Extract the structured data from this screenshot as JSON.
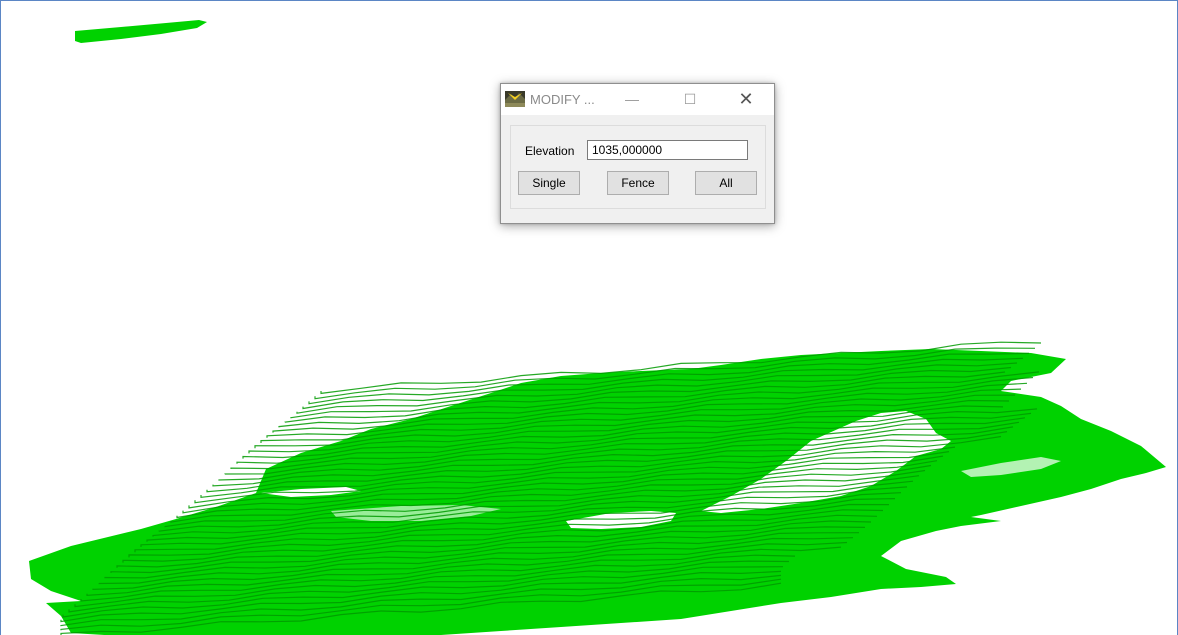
{
  "dialog": {
    "title": "MODIFY ...",
    "min_glyph": "—",
    "max_glyph": "☐",
    "close_glyph": "✕",
    "elevation_label": "Elevation",
    "elevation_value": "1035,000000",
    "buttons": {
      "single": "Single",
      "fence": "Fence",
      "all": "All"
    }
  },
  "canvas": {
    "background": "#ffffff",
    "contour_color": "#00d200",
    "contour_dark": "#009a00"
  }
}
